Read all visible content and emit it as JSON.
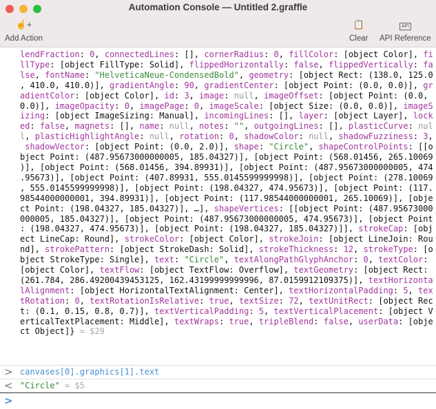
{
  "window": {
    "title": "Automation Console — Untitled 2.graffle",
    "traffic_lights": [
      "#ed5f57",
      "#f3b335",
      "#2bbf40"
    ]
  },
  "toolbar": {
    "add_action": {
      "label": "Add Action",
      "icon": "hand-plus-icon"
    },
    "clear": {
      "label": "Clear",
      "icon": "clear-clipboard-icon"
    },
    "api_reference": {
      "label": "API Reference",
      "icon_text": "API"
    }
  },
  "console": {
    "result_text": "lendFraction: 0, connectedLines: [], cornerRadius: 0, fillColor: [object Color], fillType: [object FillType: Solid], flippedHorizontally: false, flippedVertically: false, fontName: \"HelveticaNeue-CondensedBold\", geometry: [object Rect: (138.0, 125.0, 410.0, 410.0)], gradientAngle: 90, gradientCenter: [object Point: (0.0, 0.0)], gradientColor: [object Color], id: 3, image: null, imageOffset: [object Point: (0.0, 0.0)], imageOpacity: 0, imagePage: 0, imageScale: [object Size: (0.0, 0.0)], imageSizing: [object ImageSizing: Manual], incomingLines: [], layer: [object Layer], locked: false, magnets: [], name: null, notes: \"\", outgoingLines: [], plasticCurve: null, plasticHighlightAngle: null, rotation: 0, shadowColor: null, shadowFuzziness: 3, shadowVector: [object Point: (0.0, 2.0)], shape: \"Circle\", shapeControlPoints: [[object Point: (487.95673000000005, 185.04327)], [object Point: (568.01456, 265.10069)], [object Point: (568.01456, 394.89931)], [object Point: (487.95673000000005, 474.95673)], [object Point: (407.89931, 555.0145599999998)], [object Point: (278.10069, 555.0145599999998)], [object Point: (198.04327, 474.95673)], [object Point: (117.98544000000001, 394.89931)], [object Point: (117.98544000000001, 265.10069)], [object Point: (198.04327, 185.04327)], …], shapeVertices: [[object Point: (487.95673000000005, 185.04327)], [object Point: (487.95673000000005, 474.95673)], [object Point: (198.04327, 474.95673)], [object Point: (198.04327, 185.04327)]], strokeCap: [object LineCap: Round], strokeColor: [object Color], strokeJoin: [object LineJoin: Round], strokePattern: [object StrokeDash: Solid], strokeThickness: 12, strokeType: [object StrokeType: Single], text: \"Circle\", textAlongPathGlyphAnchor: 0, textColor: [object Color], textFlow: [object TextFlow: Overflow], textGeometry: [object Rect: (261.784, 286.49200439453125, 162.43199999999996, 87.0159912109375)], textHorizontalAlignment: [object HorizontalTextAlignment: Center], textHorizontalPadding: 5, textRotation: 0, textRotationIsRelative: true, textSize: 72, textUnitRect: [object Rect: (0.1, 0.15, 0.8, 0.7)], textVerticalPadding: 5, textVerticalPlacement: [object VerticalTextPlacement: Middle], textWraps: true, tripleBlend: false, userData: [object Object]}",
    "result_ref": " = $29",
    "command": "canvases[0].graphics[1].text",
    "command_result": "\"Circle\"",
    "command_result_ref": " = $5",
    "input_value": ""
  },
  "colors": {
    "key": "#a2369e",
    "string": "#3a8a3a",
    "null": "#9a9a9a",
    "command": "#4a8fd6"
  }
}
